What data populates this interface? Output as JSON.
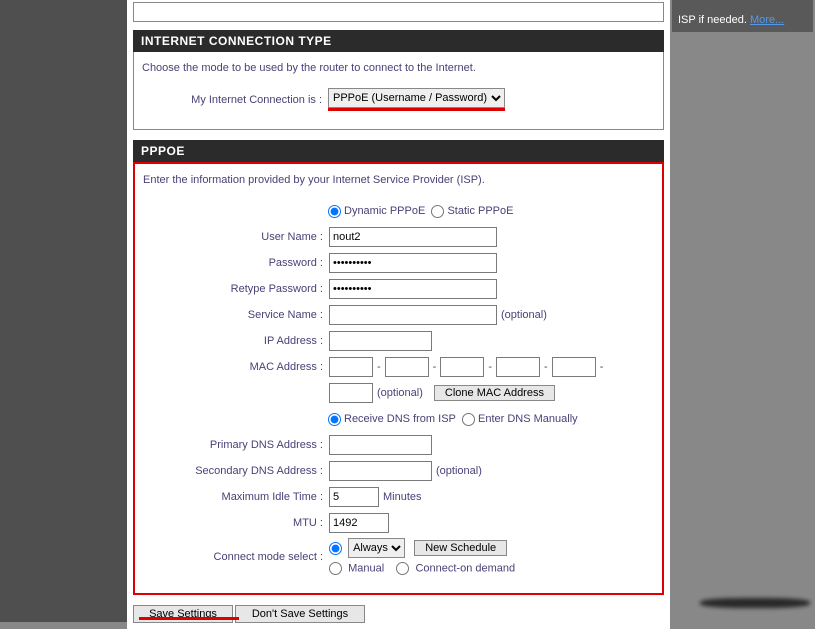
{
  "side": {
    "text": "ISP if needed.",
    "more": "More..."
  },
  "sections": {
    "ict": {
      "title": "INTERNET CONNECTION TYPE",
      "desc": "Choose the mode to be used by the router to connect to the Internet.",
      "label": "My Internet Connection is :",
      "option": "PPPoE (Username / Password)"
    },
    "pppoe": {
      "title": "PPPOE",
      "desc": "Enter the information provided by your Internet Service Provider (ISP).",
      "mode_dynamic": "Dynamic PPPoE",
      "mode_static": "Static PPPoE",
      "labels": {
        "user": "User Name :",
        "pass": "Password :",
        "repass": "Retype Password :",
        "service": "Service Name :",
        "ip": "IP Address :",
        "mac": "MAC Address :",
        "clone": "Clone MAC Address",
        "dns_isp": "Receive DNS from ISP",
        "dns_manual": "Enter DNS Manually",
        "pdns": "Primary DNS Address :",
        "sdns": "Secondary DNS Address :",
        "idle": "Maximum Idle Time :",
        "minutes": "Minutes",
        "mtu": "MTU :",
        "connect": "Connect mode select :",
        "always": "Always",
        "newsched": "New Schedule",
        "manual": "Manual",
        "ondemand": "Connect-on demand",
        "optional": "(optional)"
      },
      "values": {
        "user": "nout2",
        "pass": "••••••••••",
        "repass": "••••••••••",
        "service": "",
        "ip": "",
        "mac": [
          "",
          "",
          "",
          "",
          "",
          ""
        ],
        "pdns": "",
        "sdns": "",
        "idle": "5",
        "mtu": "1492"
      }
    }
  },
  "buttons": {
    "save": "Save Settings",
    "dont": "Don't Save Settings"
  }
}
